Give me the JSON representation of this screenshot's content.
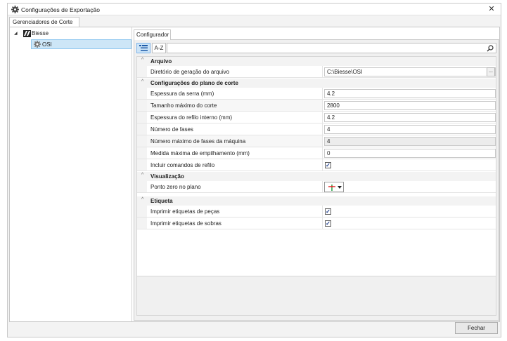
{
  "window": {
    "title": "Configurações de Exportação",
    "close_glyph": "✕"
  },
  "outer_tab": {
    "label": "Gerenciadores de Corte"
  },
  "tree": {
    "root": {
      "label": "Biesse",
      "expander": "◢"
    },
    "child": {
      "label": "OSI"
    }
  },
  "inner_tab": {
    "label": "Configurador"
  },
  "toolbar": {
    "categorized_glyph": "☷",
    "alphabetical_label": "A-Z",
    "search_placeholder": ""
  },
  "grid": {
    "categories": [
      {
        "label": "Arquivo",
        "properties": [
          {
            "name": "Diretório de geração do arquivo",
            "value": "C:\\Biesse\\OSI",
            "button": "..."
          }
        ]
      },
      {
        "label": "Configurações do plano de corte",
        "properties": [
          {
            "name": "Espessura da serra (mm)",
            "value": "4.2"
          },
          {
            "name": "Tamanho máximo do corte",
            "value": "2800"
          },
          {
            "name": "Espessura do refilo interno (mm)",
            "value": "4.2"
          },
          {
            "name": "Número de fases",
            "value": "4"
          },
          {
            "name": "Número máximo de fases da máquina",
            "value": "4",
            "readonly": true
          },
          {
            "name": "Medida máxima de empilhamento (mm)",
            "value": "0"
          },
          {
            "name": "Incluir comandos de refilo",
            "checked": true
          }
        ]
      },
      {
        "label": "Visualização",
        "properties": [
          {
            "name": "Ponto zero no plano"
          }
        ]
      },
      {
        "label": "Etiqueta",
        "properties": [
          {
            "name": "Imprimir etiquetas de peças",
            "checked": true
          },
          {
            "name": "Imprimir etiquetas de sobras",
            "checked": true
          }
        ]
      }
    ],
    "check_glyph": "✓",
    "collapse_glyph": "^"
  },
  "footer": {
    "close_button": "Fechar"
  },
  "colors": {
    "selection": "#cde6f7",
    "accent_red": "#e03030",
    "accent_green": "#20a040"
  }
}
